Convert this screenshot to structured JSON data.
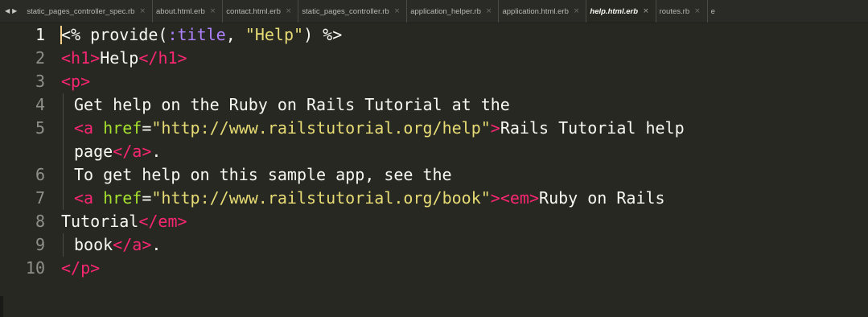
{
  "tabs": [
    {
      "label": "static_pages_controller_spec.rb",
      "active": false
    },
    {
      "label": "about.html.erb",
      "active": false
    },
    {
      "label": "contact.html.erb",
      "active": false
    },
    {
      "label": "static_pages_controller.rb",
      "active": false
    },
    {
      "label": "application_helper.rb",
      "active": false
    },
    {
      "label": "application.html.erb",
      "active": false
    },
    {
      "label": "help.html.erb",
      "active": true
    },
    {
      "label": "routes.rb",
      "active": false
    },
    {
      "label": "e",
      "active": false
    }
  ],
  "close_glyph": "×",
  "nav": {
    "back": "◀",
    "forward": "▶"
  },
  "current_line": 1,
  "lines": [
    {
      "num": "1",
      "tokens": [
        {
          "t": "<%",
          "c": "erb"
        },
        {
          "t": " provide(",
          "c": "fn"
        },
        {
          "t": ":title",
          "c": "sym"
        },
        {
          "t": ", ",
          "c": "punc"
        },
        {
          "t": "\"Help\"",
          "c": "str"
        },
        {
          "t": ") ",
          "c": "fn"
        },
        {
          "t": "%>",
          "c": "erb"
        }
      ]
    },
    {
      "num": "2",
      "tokens": [
        {
          "t": "<",
          "c": "tag"
        },
        {
          "t": "h1",
          "c": "tag"
        },
        {
          "t": ">",
          "c": "tag"
        },
        {
          "t": "Help",
          "c": "punc"
        },
        {
          "t": "</",
          "c": "tag"
        },
        {
          "t": "h1",
          "c": "tag"
        },
        {
          "t": ">",
          "c": "tag"
        }
      ]
    },
    {
      "num": "3",
      "tokens": [
        {
          "t": "<",
          "c": "tag"
        },
        {
          "t": "p",
          "c": "tag"
        },
        {
          "t": ">",
          "c": "tag"
        }
      ]
    },
    {
      "num": "4",
      "indented": true,
      "tokens": [
        {
          "t": "Get help on the Ruby on Rails Tutorial at the",
          "c": "punc"
        }
      ]
    },
    {
      "num": "5",
      "indented": true,
      "tokens": [
        {
          "t": "<",
          "c": "tag"
        },
        {
          "t": "a",
          "c": "tag"
        },
        {
          "t": " href",
          "c": "attr"
        },
        {
          "t": "=",
          "c": "punc"
        },
        {
          "t": "\"http://www.railstutorial.org/help\"",
          "c": "str"
        },
        {
          "t": ">",
          "c": "tag"
        },
        {
          "t": "Rails Tutorial help",
          "c": "punc"
        }
      ]
    },
    {
      "num": "",
      "indented": true,
      "tokens": [
        {
          "t": "page",
          "c": "punc"
        },
        {
          "t": "</",
          "c": "tag"
        },
        {
          "t": "a",
          "c": "tag"
        },
        {
          "t": ">",
          "c": "tag"
        },
        {
          "t": ".",
          "c": "punc"
        }
      ]
    },
    {
      "num": "6",
      "indented": true,
      "tokens": [
        {
          "t": "To get help on this sample app, see the",
          "c": "punc"
        }
      ]
    },
    {
      "num": "7",
      "indented": true,
      "tokens": [
        {
          "t": "<",
          "c": "tag"
        },
        {
          "t": "a",
          "c": "tag"
        },
        {
          "t": " href",
          "c": "attr"
        },
        {
          "t": "=",
          "c": "punc"
        },
        {
          "t": "\"http://www.railstutorial.org/book\"",
          "c": "str"
        },
        {
          "t": ">",
          "c": "tag"
        },
        {
          "t": "<",
          "c": "tag"
        },
        {
          "t": "em",
          "c": "tag"
        },
        {
          "t": ">",
          "c": "tag"
        },
        {
          "t": "Ruby on Rails",
          "c": "punc"
        }
      ]
    },
    {
      "num": "8",
      "tokens": [
        {
          "t": "Tutorial",
          "c": "punc"
        },
        {
          "t": "</",
          "c": "tag"
        },
        {
          "t": "em",
          "c": "tag"
        },
        {
          "t": ">",
          "c": "tag"
        }
      ]
    },
    {
      "num": "9",
      "indented": true,
      "tokens": [
        {
          "t": "book",
          "c": "punc"
        },
        {
          "t": "</",
          "c": "tag"
        },
        {
          "t": "a",
          "c": "tag"
        },
        {
          "t": ">",
          "c": "tag"
        },
        {
          "t": ".",
          "c": "punc"
        }
      ]
    },
    {
      "num": "10",
      "tokens": [
        {
          "t": "</",
          "c": "tag"
        },
        {
          "t": "p",
          "c": "tag"
        },
        {
          "t": ">",
          "c": "tag"
        }
      ]
    }
  ],
  "colors": {
    "background": "#272822",
    "tag": "#f92672",
    "string": "#e6db74",
    "attribute": "#a6e22e",
    "symbol": "#ae81ff",
    "text": "#f8f8f2",
    "cursor": "#f8d088"
  }
}
